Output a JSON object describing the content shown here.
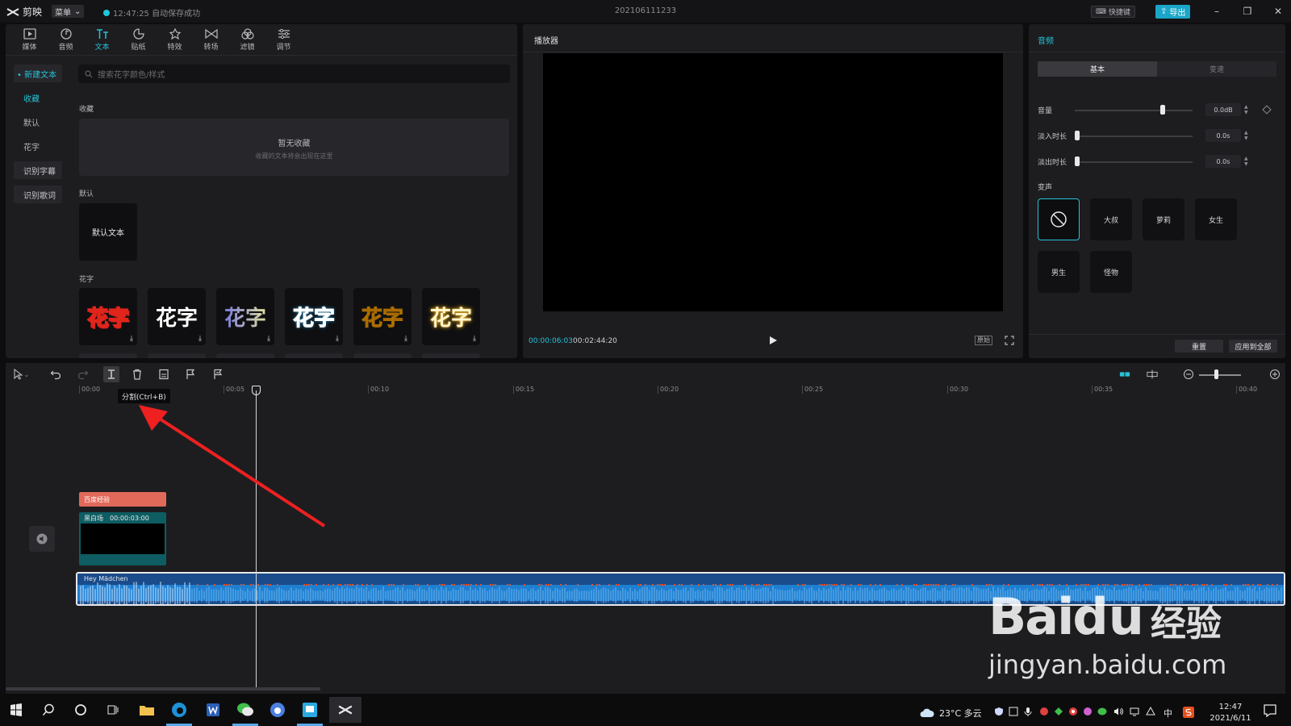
{
  "app": {
    "name": "剪映",
    "menu_label": "菜单",
    "save_status": "12:47:25 自动保存成功",
    "project_title": "202106111233",
    "shortcut_label": "快捷键",
    "export_label": "导出"
  },
  "toolbar_tabs": [
    {
      "label": "媒体",
      "icon": "media-icon"
    },
    {
      "label": "音频",
      "icon": "audio-icon"
    },
    {
      "label": "文本",
      "icon": "text-icon",
      "active": true
    },
    {
      "label": "贴纸",
      "icon": "sticker-icon"
    },
    {
      "label": "特效",
      "icon": "effects-icon"
    },
    {
      "label": "转场",
      "icon": "transition-icon"
    },
    {
      "label": "滤镜",
      "icon": "filter-icon"
    },
    {
      "label": "调节",
      "icon": "adjust-icon"
    }
  ],
  "side_nav": {
    "new_text": "• 新建文本",
    "favorites": "收藏",
    "default": "默认",
    "fancy": "花字",
    "recognize_subtitles": "识别字幕",
    "recognize_lyrics": "识别歌词"
  },
  "text_library": {
    "search_placeholder": "搜索花字颜色/样式",
    "favorites_heading": "收藏",
    "empty_title": "暂无收藏",
    "empty_subtitle": "收藏的文本将会出现在这里",
    "default_heading": "默认",
    "default_tile": "默认文本",
    "fancy_heading": "花字",
    "fancy_tiles": [
      {
        "text": "花字",
        "style": "red"
      },
      {
        "text": "花字",
        "style": "white"
      },
      {
        "text": "花字",
        "style": "gradient"
      },
      {
        "text": "花字",
        "style": "cyan"
      },
      {
        "text": "花字",
        "style": "gold"
      },
      {
        "text": "花字",
        "style": "glow"
      }
    ],
    "download_glyph": "⤓"
  },
  "player": {
    "title": "播放器",
    "current_time": "00:00:06:03",
    "total_time": "00:02:44:20",
    "ratio_label": "原始"
  },
  "audio_panel": {
    "title": "音频",
    "tab_basic": "基本",
    "tab_speed": "变速",
    "volume_label": "音量",
    "volume_value": "0.0dB",
    "volume_level": 0.75,
    "fade_in_label": "淡入时长",
    "fade_in_value": "0.0s",
    "fade_out_label": "淡出时长",
    "fade_out_value": "0.0s",
    "voice_change_label": "变声",
    "voice_options": [
      "大叔",
      "萝莉",
      "女生",
      "男生",
      "怪物"
    ],
    "reset_label": "重置",
    "apply_all_label": "应用到全部"
  },
  "timeline": {
    "tooltip": "分割(Ctrl+B)",
    "ruler_labels": [
      "00:00",
      "00:05",
      "00:10",
      "00:15",
      "00:20",
      "00:25",
      "00:30",
      "00:35",
      "00:40"
    ],
    "text_clip_label": "百度经验",
    "video_clip_name": "黑白场",
    "video_clip_duration": "00:00:03:00",
    "audio_clip_name": "Hey Mädchen"
  },
  "watermark": {
    "logo_bai": "Bai",
    "logo_du": "du",
    "logo_jingyan": "经验",
    "url": "jingyan.baidu.com"
  },
  "taskbar": {
    "weather": "23°C 多云",
    "time": "12:47",
    "date": "2021/6/11",
    "ime": "中"
  },
  "colors": {
    "accent": "#27c2d7",
    "export": "#1aa6c9",
    "text_clip": "#e1695a",
    "video_clip": "#0e5d62",
    "audio_clip": "#1a4b8a"
  }
}
